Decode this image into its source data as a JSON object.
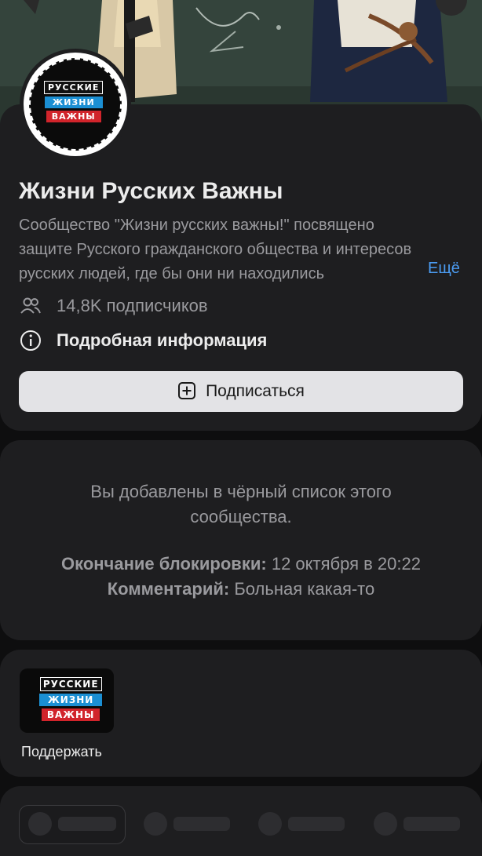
{
  "community": {
    "name": "Жизни Русских Важны",
    "description": "Сообщество \"Жизни русских важны!\" посвящено защите Русского гражданского общества и интересов русских людей, где бы они ни находились",
    "more_label": "Ещё",
    "subscribers": "14,8K подписчиков",
    "details_label": "Подробная информация",
    "subscribe_label": "Подписаться"
  },
  "logo": {
    "line1": "РУССКИЕ",
    "line2": "ЖИЗНИ",
    "line3": "ВАЖНЫ"
  },
  "blacklist": {
    "message": "Вы добавлены в чёрный список этого сообщества.",
    "end_label": "Окончание блокировки:",
    "end_value": "12 октября в 20:22",
    "comment_label": "Комментарий:",
    "comment_value": "Больная какая-то"
  },
  "support": {
    "label": "Поддержать"
  },
  "colors": {
    "background": "#0e0e0f",
    "card": "#1e1e20",
    "link": "#4b9cf2",
    "button": "#e3e3e6",
    "logo_blue": "#1b8fd3",
    "logo_red": "#d1242b"
  },
  "icons": {
    "subscribers": "people-icon",
    "details": "info-icon",
    "subscribe": "plus-square-icon"
  }
}
